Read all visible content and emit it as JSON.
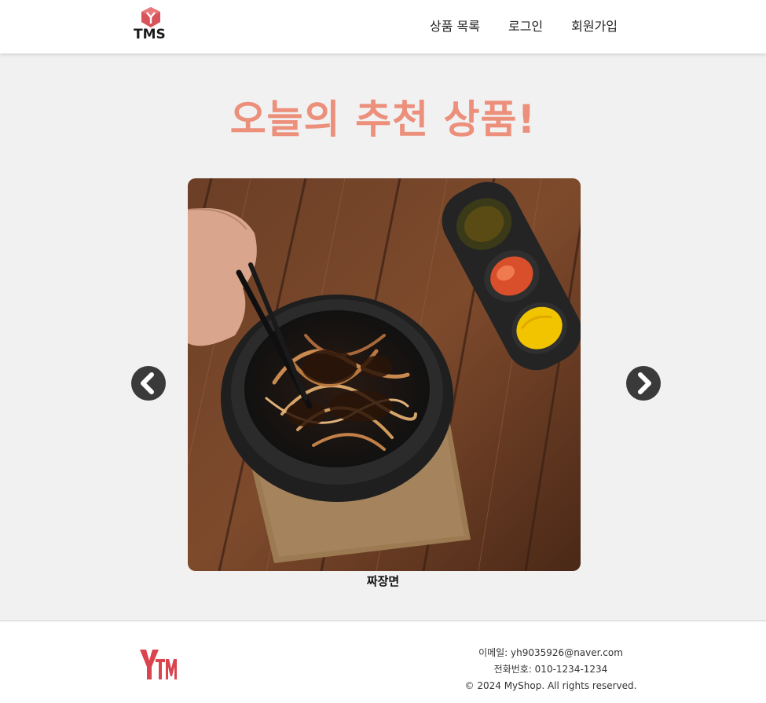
{
  "header": {
    "logo_text": "TMS",
    "nav": [
      {
        "label": "상품 목록"
      },
      {
        "label": "로그인"
      },
      {
        "label": "회원가입"
      }
    ]
  },
  "main": {
    "title": "오늘의 추천 상품!",
    "carousel": {
      "caption": "짜장면",
      "prev_icon": "chevron-left-icon",
      "next_icon": "chevron-right-icon"
    }
  },
  "footer": {
    "logo_text": "YTMS",
    "email": "이메일: yh9035926@naver.com",
    "phone": "전화번호: 010-1234-1234",
    "copyright": "© 2024 MyShop. All rights reserved."
  },
  "colors": {
    "title": "#ec8f7b",
    "arrow_bg": "#3a3a3a",
    "logo_red": "#d9444f",
    "page_bg": "#f1f1f1"
  }
}
